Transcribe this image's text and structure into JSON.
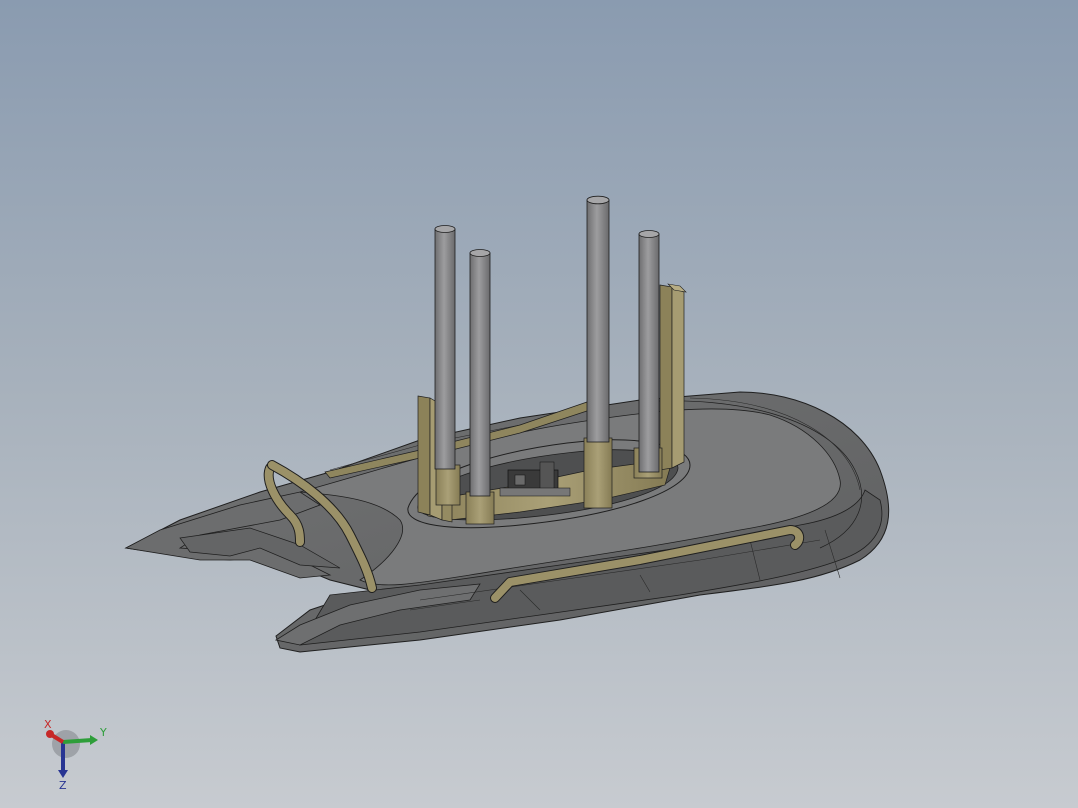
{
  "viewport": {
    "background_top": "#8a9bb0",
    "background_bottom": "#c7cbd0"
  },
  "model": {
    "hull_color": "#6a6b6c",
    "hull_light": "#7c7d7e",
    "hull_dark": "#545556",
    "frame_color": "#9b9168",
    "tube_color": "#8a8a8c",
    "edge_color": "#1f1f1f"
  },
  "triad": {
    "x_label": "X",
    "y_label": "Y",
    "z_label": "Z",
    "x_color": "#c62828",
    "y_color": "#2e9e3a",
    "z_color": "#283593"
  }
}
